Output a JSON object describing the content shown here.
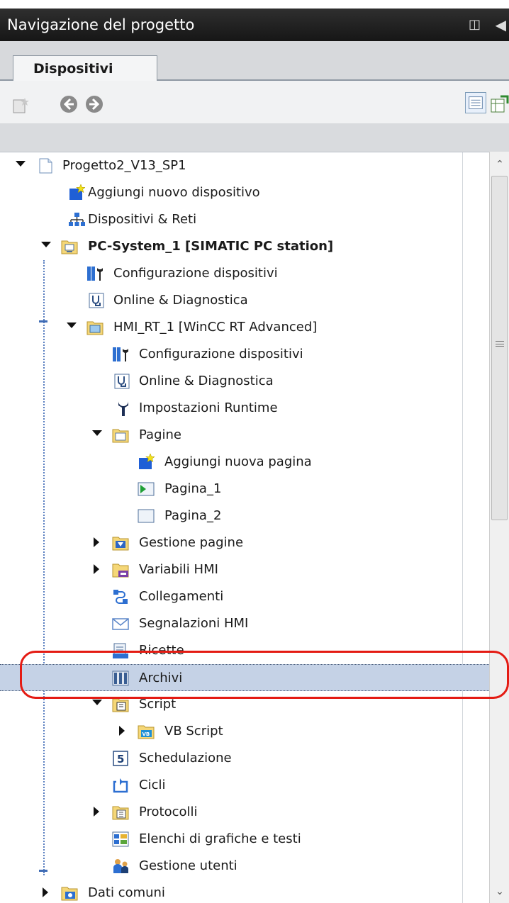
{
  "panel": {
    "title": "Navigazione del progetto",
    "tab_label": "Dispositivi"
  },
  "toolbar": {
    "icons": [
      "new-item-icon",
      "back-icon",
      "forward-icon",
      "details-view-icon",
      "export-icon"
    ]
  },
  "colors": {
    "header": "#1f1f1f",
    "selection": "#c5d2e6",
    "annotation": "#e41b13",
    "tree_line": "#5a7fc0"
  },
  "tree": {
    "project": "Progetto2_V13_SP1",
    "add_device": "Aggiungi nuovo dispositivo",
    "devices_networks": "Dispositivi & Reti",
    "pc_system": "PC-System_1 [SIMATIC PC station]",
    "pc_device_config": "Configurazione dispositivi",
    "pc_online_diag": "Online & Diagnostica",
    "hmi_rt": "HMI_RT_1 [WinCC RT Advanced]",
    "hmi_device_config": "Configurazione dispositivi",
    "hmi_online_diag": "Online & Diagnostica",
    "runtime_settings": "Impostazioni Runtime",
    "screens": "Pagine",
    "add_screen": "Aggiungi nuova pagina",
    "screen_1": "Pagina_1",
    "screen_2": "Pagina_2",
    "screen_management": "Gestione pagine",
    "hmi_tags": "Variabili HMI",
    "connections": "Collegamenti",
    "hmi_alarms": "Segnalazioni HMI",
    "recipes": "Ricette",
    "archives": "Archivi",
    "scripts": "Script",
    "vb_scripts": "VB Script",
    "scheduler": "Schedulazione",
    "cycles": "Cicli",
    "reports": "Protocolli",
    "text_graphic_lists": "Elenchi di grafiche e testi",
    "user_admin": "Gestione utenti",
    "common_data": "Dati comuni"
  }
}
